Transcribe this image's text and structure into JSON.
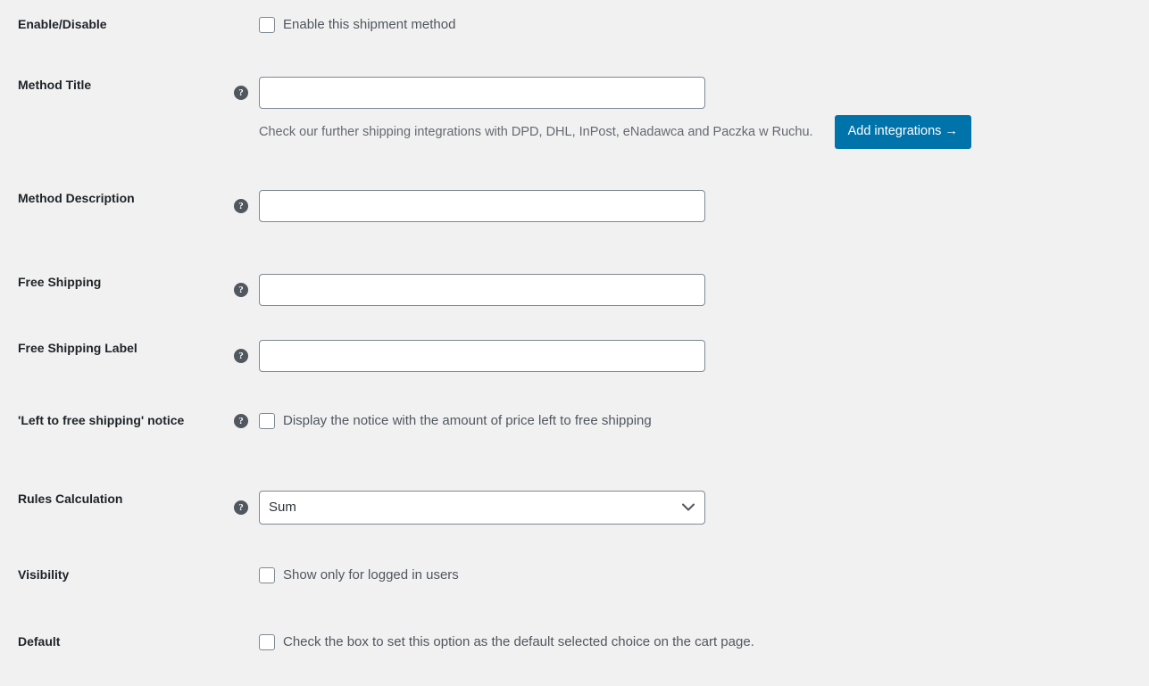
{
  "page": {
    "background": "#f1f1f1",
    "accent_color": "#0073aa",
    "border_color": "#7e8993",
    "label_color": "#1d2327"
  },
  "help_icon_glyph": "?",
  "rows": {
    "enable_disable": {
      "label": "Enable/Disable",
      "checkbox_label": "Enable this shipment method",
      "checked": false
    },
    "method_title": {
      "label": "Method Title",
      "value": "",
      "placeholder": "",
      "description": "Check our further shipping integrations with DPD, DHL, InPost, eNadawca and Paczka w Ruchu.",
      "button_label": "Add integrations →"
    },
    "method_description": {
      "label": "Method Description",
      "value": "",
      "placeholder": ""
    },
    "free_shipping": {
      "label": "Free Shipping",
      "value": "",
      "placeholder": ""
    },
    "free_shipping_label": {
      "label": "Free Shipping Label",
      "value": "",
      "placeholder": ""
    },
    "left_to_free_shipping_notice": {
      "label": "'Left to free shipping' notice",
      "checkbox_label": "Display the notice with the amount of price left to free shipping",
      "checked": false
    },
    "rules_calculation": {
      "label": "Rules Calculation",
      "selected": "Sum",
      "options": [
        "Sum"
      ]
    },
    "visibility": {
      "label": "Visibility",
      "checkbox_label": "Show only for logged in users",
      "checked": false
    },
    "default": {
      "label": "Default",
      "checkbox_label": "Check the box to set this option as the default selected choice on the cart page.",
      "checked": false
    }
  }
}
